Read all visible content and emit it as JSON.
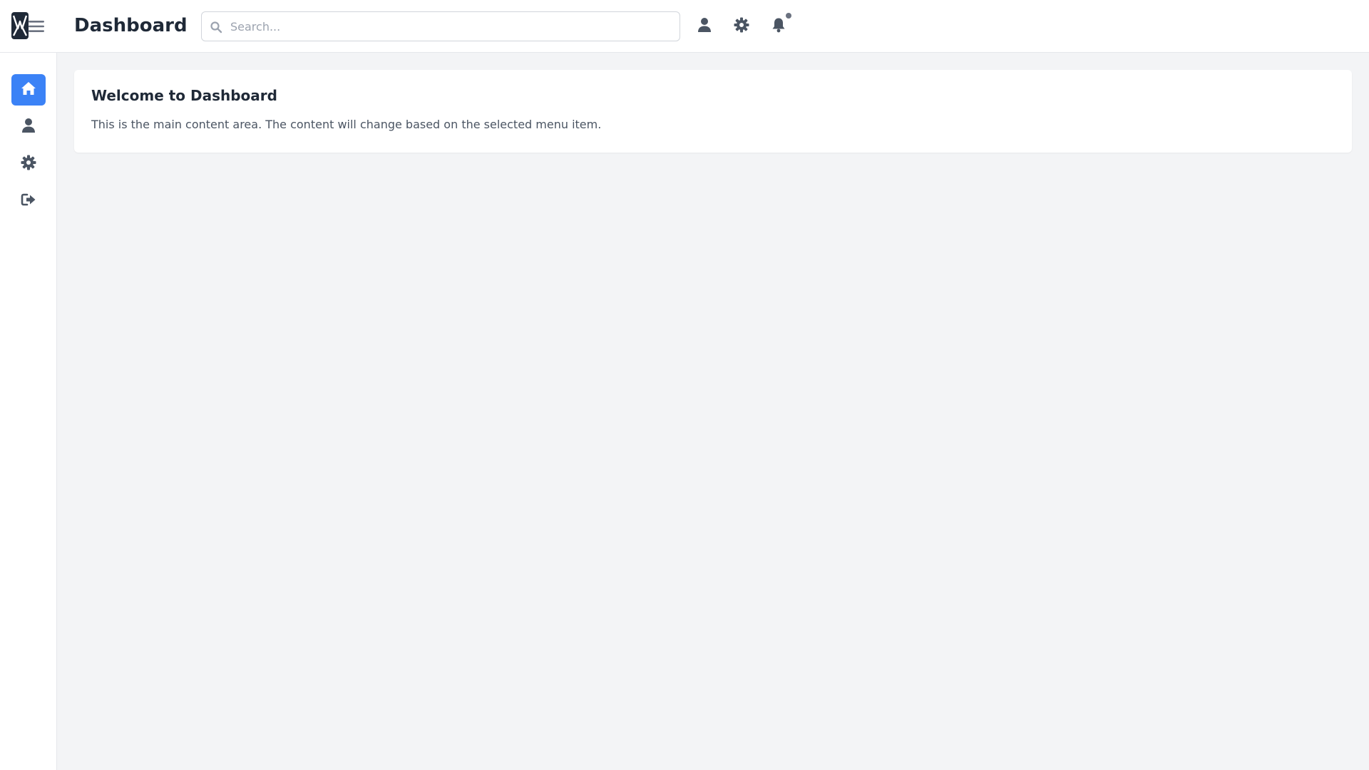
{
  "header": {
    "title": "Dashboard",
    "search": {
      "placeholder": "Search...",
      "value": ""
    },
    "icons": [
      "user-icon",
      "gear-icon",
      "bell-icon"
    ],
    "has_notification": true
  },
  "sidebar": {
    "items": [
      {
        "id": "home",
        "icon": "home-icon",
        "active": true
      },
      {
        "id": "profile",
        "icon": "user-icon",
        "active": false
      },
      {
        "id": "settings",
        "icon": "gear-icon",
        "active": false
      },
      {
        "id": "logout",
        "icon": "logout-icon",
        "active": false
      }
    ]
  },
  "main": {
    "card": {
      "title": "Welcome to Dashboard",
      "text": "This is the main content area. The content will change based on the selected menu item."
    }
  },
  "colors": {
    "accent": "#3b82f6",
    "icon": "#4b5563",
    "background": "#f3f4f6",
    "surface": "#ffffff"
  }
}
